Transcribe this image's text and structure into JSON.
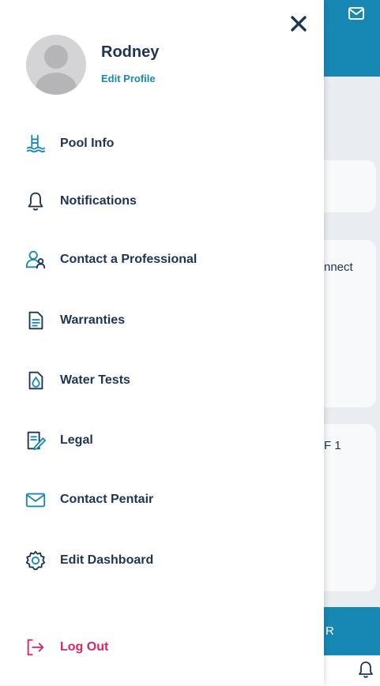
{
  "background": {
    "fragments": [
      "nnect",
      "F 1",
      "R"
    ]
  },
  "drawer": {
    "user": {
      "name": "Rodney",
      "edit_profile_label": "Edit Profile"
    },
    "menu": [
      {
        "label": "Pool Info",
        "icon": "pool-ladder-icon"
      },
      {
        "label": "Notifications",
        "icon": "bell-icon"
      },
      {
        "label": "Contact a Professional",
        "icon": "professional-users-icon"
      },
      {
        "label": "Warranties",
        "icon": "document-icon"
      },
      {
        "label": "Water Tests",
        "icon": "water-drop-icon"
      },
      {
        "label": "Legal",
        "icon": "legal-pen-icon"
      },
      {
        "label": "Contact Pentair",
        "icon": "envelope-icon"
      },
      {
        "label": "Edit Dashboard",
        "icon": "gear-icon"
      }
    ],
    "logout_label": "Log Out"
  },
  "colors": {
    "primary_text": "#1d3456",
    "accent": "#1789b4",
    "logout": "#e0245e",
    "header": "#1788b3"
  }
}
